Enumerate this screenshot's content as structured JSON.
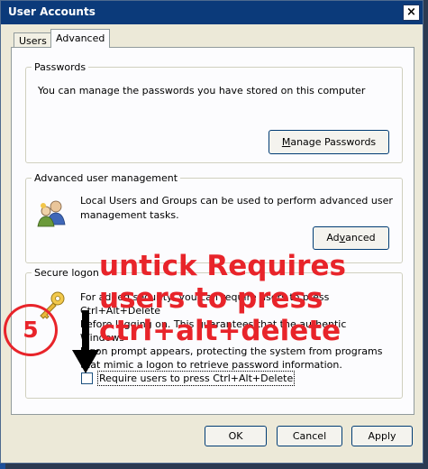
{
  "window": {
    "title": "User Accounts",
    "close_glyph": "×"
  },
  "tabs": [
    {
      "label": "Users",
      "active": false
    },
    {
      "label": "Advanced",
      "active": true
    }
  ],
  "passwords": {
    "legend": "Passwords",
    "description": "You can manage the passwords you have stored on this computer",
    "button_label": "Manage Passwords",
    "button_accel": "M"
  },
  "advanced_mgmt": {
    "legend": "Advanced user management",
    "description_line1": "Local Users and Groups can be used to perform advanced user",
    "description_line2": "management tasks.",
    "button_label": "Advanced",
    "button_accel": "v",
    "icon": "users-group-icon"
  },
  "secure_logon": {
    "legend": "Secure logon",
    "description_line1": "For added security, you can require users to press Ctrl+Alt+Delete",
    "description_line2": "before logging on. This guarantees that the authentic Windows",
    "description_line3": "logon prompt appears, protecting the system from programs",
    "description_line4": "that mimic a logon to retrieve password information.",
    "checkbox_label": "Require users to press Ctrl+Alt+Delete",
    "checkbox_checked": false,
    "icon": "key-icon"
  },
  "footer": {
    "ok_label": "OK",
    "cancel_label": "Cancel",
    "apply_label": "Apply"
  },
  "annotation": {
    "line1": "untick Requires",
    "line2": "users to press",
    "line3": "ctrl+alt+delete",
    "step_number": "5",
    "color": "#e8242a"
  }
}
